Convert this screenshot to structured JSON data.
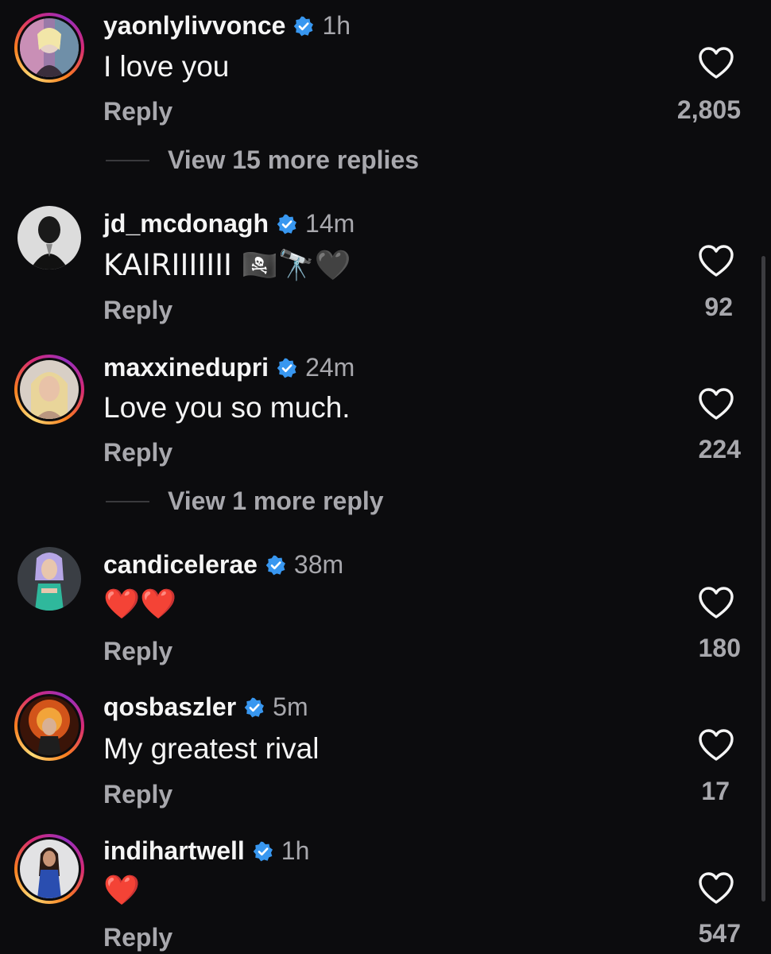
{
  "comments": [
    {
      "username": "yaonlylivvonce",
      "time": "1h",
      "text": "I love you",
      "reply_label": "Reply",
      "likes": "2,805",
      "verified": true,
      "story_ring": true,
      "more_replies": "View 15 more replies"
    },
    {
      "username": "jd_mcdonagh",
      "time": "14m",
      "text": "KAIRIIIIIII 🏴‍☠️🔭🖤",
      "reply_label": "Reply",
      "likes": "92",
      "verified": true,
      "story_ring": false
    },
    {
      "username": "maxxinedupri",
      "time": "24m",
      "text": "Love you so much.",
      "reply_label": "Reply",
      "likes": "224",
      "verified": true,
      "story_ring": true,
      "more_replies": "View 1 more reply"
    },
    {
      "username": "candicelerae",
      "time": "38m",
      "text": "❤️❤️",
      "reply_label": "Reply",
      "likes": "180",
      "verified": true,
      "story_ring": false
    },
    {
      "username": "qosbaszler",
      "time": "5m",
      "text": "My greatest rival",
      "reply_label": "Reply",
      "likes": "17",
      "verified": true,
      "story_ring": true
    },
    {
      "username": "indihartwell",
      "time": "1h",
      "text": "❤️",
      "reply_label": "Reply",
      "likes": "547",
      "verified": true,
      "story_ring": true
    }
  ],
  "icons": {
    "verified": "verified-badge-icon",
    "like": "heart-outline-icon"
  },
  "colors": {
    "background": "#0c0c0e",
    "verified": "#3897f0",
    "muted": "#a8a8ad"
  }
}
